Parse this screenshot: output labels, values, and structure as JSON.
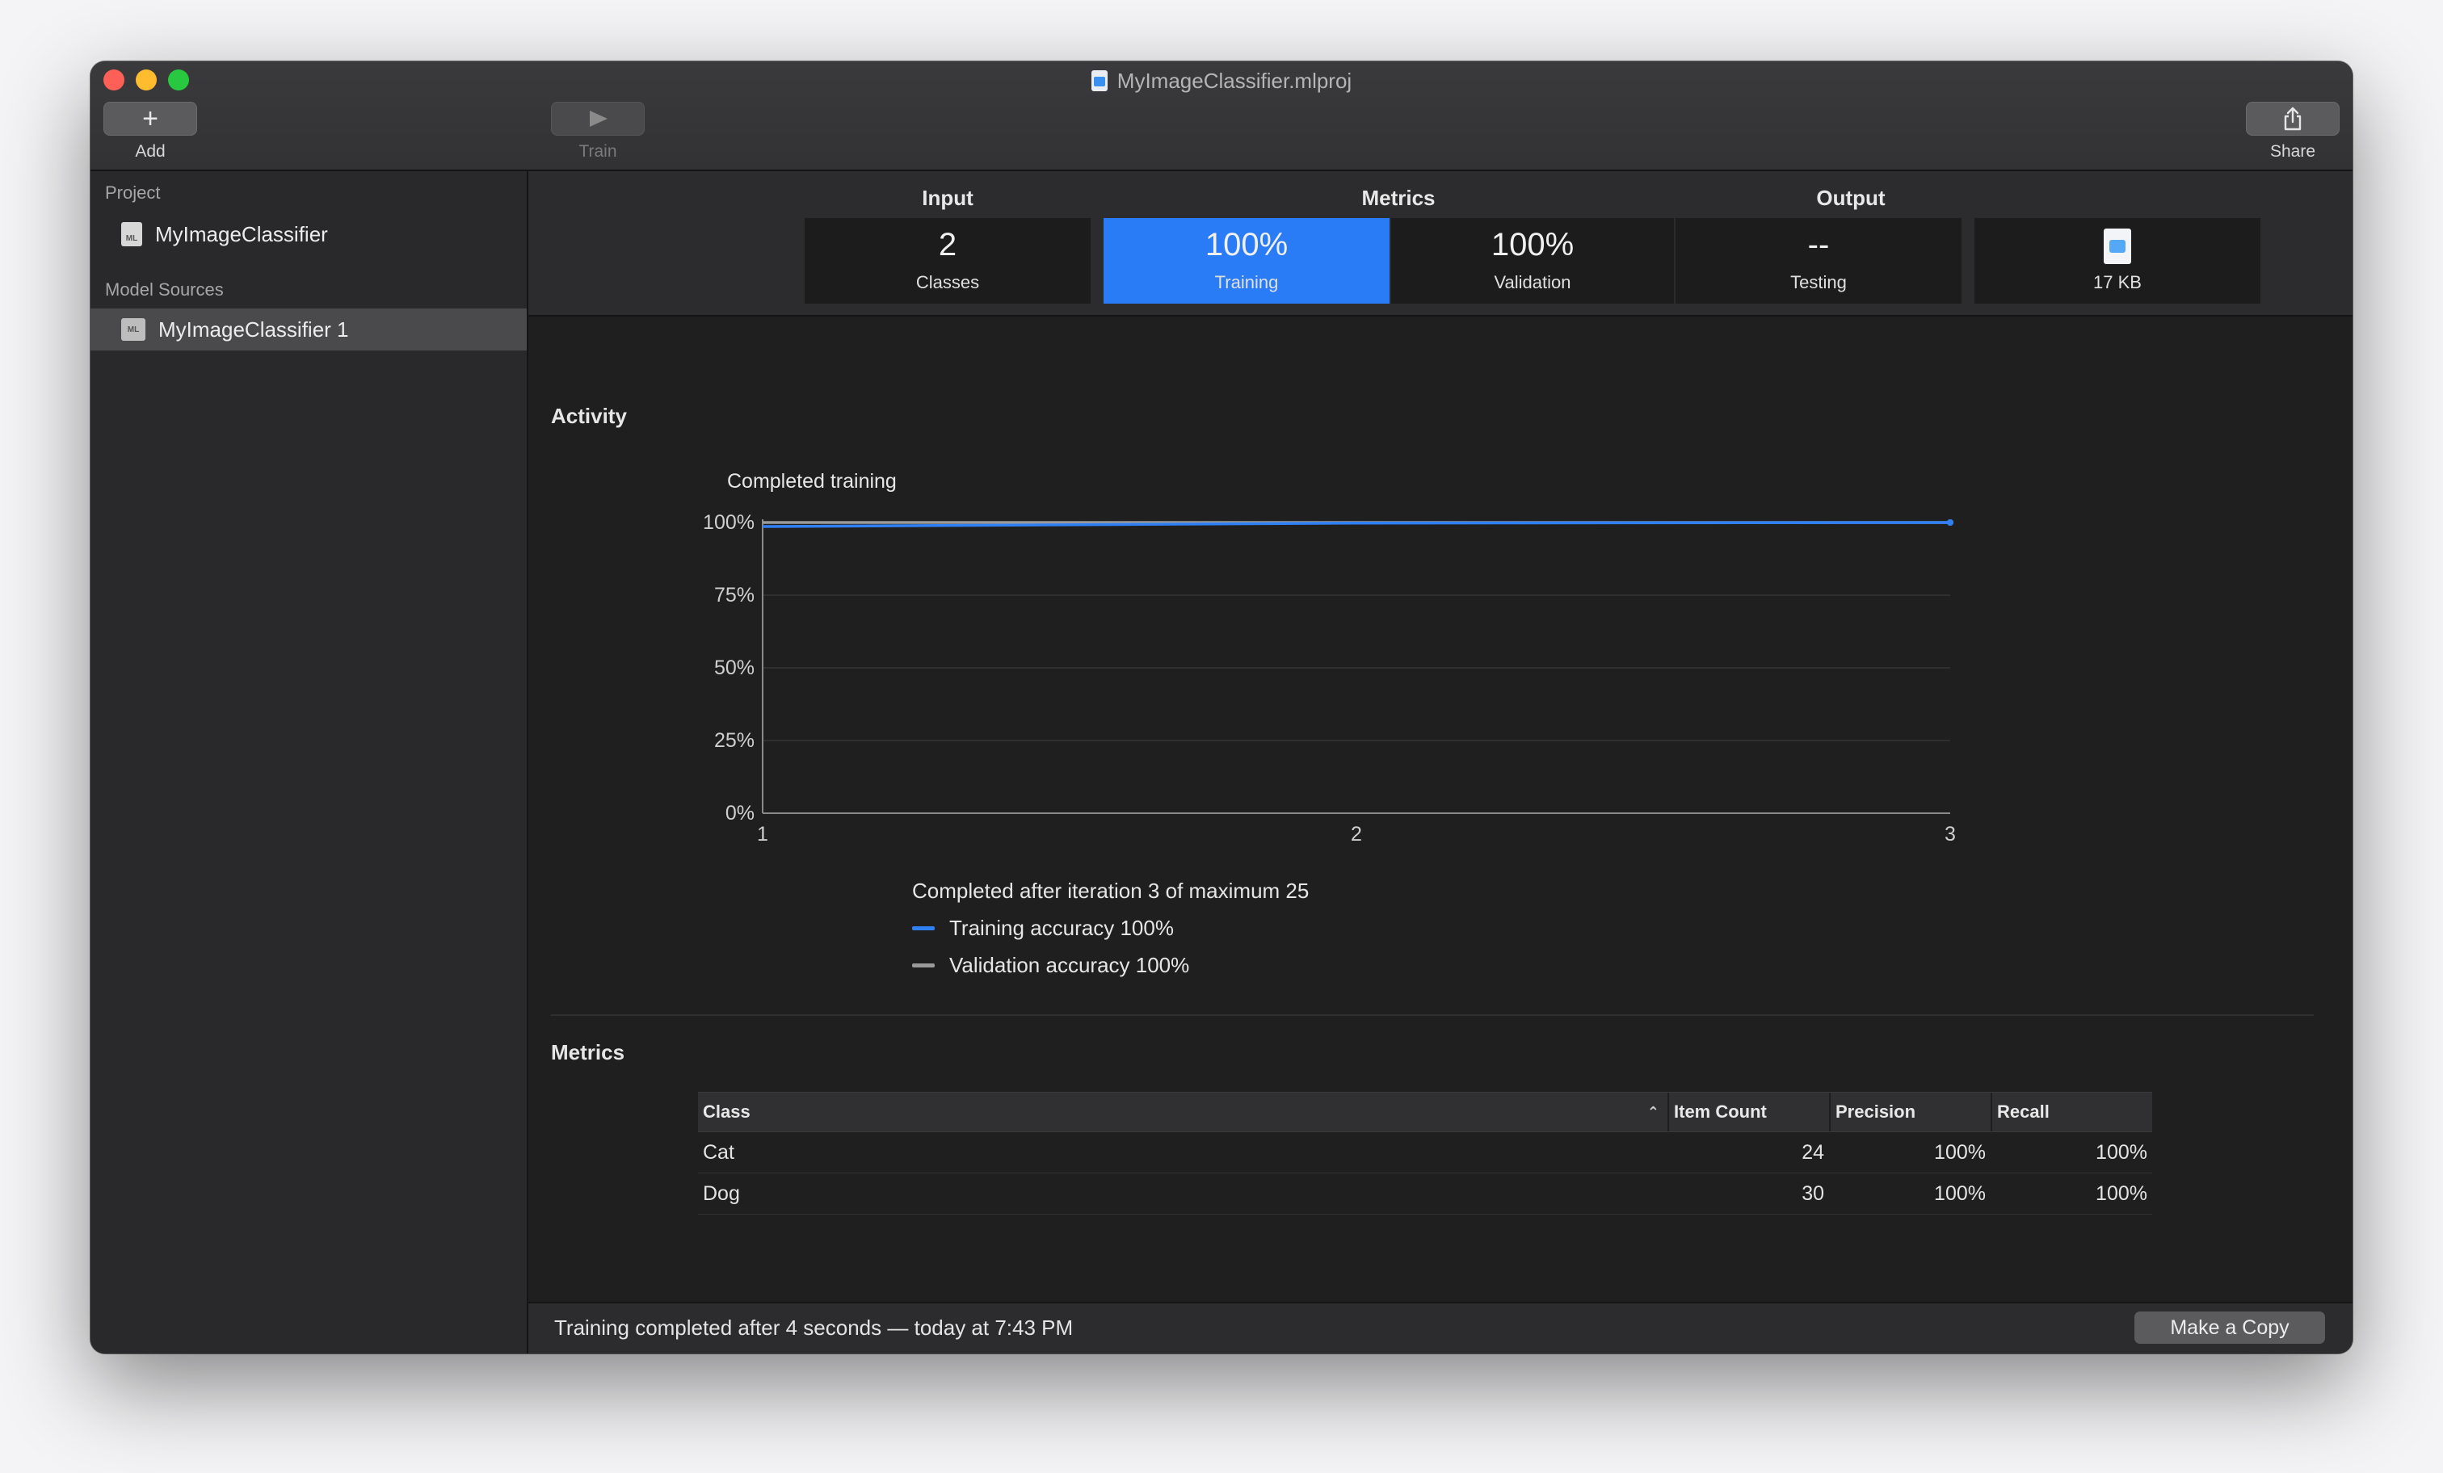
{
  "window": {
    "title": "MyImageClassifier.mlproj"
  },
  "toolbar": {
    "add_label": "Add",
    "add_icon": "+",
    "train_label": "Train",
    "train_icon": "play-icon",
    "share_label": "Share",
    "share_icon": "share-icon"
  },
  "sidebar": {
    "project_header": "Project",
    "project_item": "MyImageClassifier",
    "sources_header": "Model Sources",
    "source_item": "MyImageClassifier 1",
    "source_icon_text": "ML"
  },
  "summary": {
    "input_header": "Input",
    "metrics_header": "Metrics",
    "output_header": "Output",
    "classes_value": "2",
    "classes_label": "Classes",
    "training_value": "100%",
    "training_label": "Training",
    "validation_value": "100%",
    "validation_label": "Validation",
    "testing_value": "--",
    "testing_label": "Testing",
    "output_size": "17 KB"
  },
  "activity": {
    "title": "Activity",
    "chart_title": "Completed training",
    "summary": "Completed after iteration 3 of maximum 25",
    "legend": [
      {
        "label": "Training accuracy 100%",
        "color": "#2f7ff5"
      },
      {
        "label": "Validation accuracy 100%",
        "color": "#9a9a9a"
      }
    ]
  },
  "chart_data": {
    "type": "line",
    "title": "Completed training",
    "x": [
      1,
      2,
      3
    ],
    "xticks": [
      "1",
      "2",
      "3"
    ],
    "yticks": [
      "0%",
      "25%",
      "50%",
      "75%",
      "100%"
    ],
    "ylim": [
      0,
      100
    ],
    "grid": true,
    "series": [
      {
        "name": "Training accuracy 100%",
        "color": "#2f7ff5",
        "values": [
          98.6,
          99.8,
          100
        ]
      },
      {
        "name": "Validation accuracy 100%",
        "color": "#9a9a9a",
        "values": [
          100,
          100,
          100
        ]
      }
    ]
  },
  "metrics": {
    "title": "Metrics",
    "columns": [
      "Class",
      "Item Count",
      "Precision",
      "Recall"
    ],
    "rows": [
      {
        "class": "Cat",
        "count": "24",
        "precision": "100%",
        "recall": "100%"
      },
      {
        "class": "Dog",
        "count": "30",
        "precision": "100%",
        "recall": "100%"
      }
    ]
  },
  "status": {
    "text": "Training completed after 4 seconds — today at 7:43 PM",
    "copy_button": "Make a Copy"
  }
}
